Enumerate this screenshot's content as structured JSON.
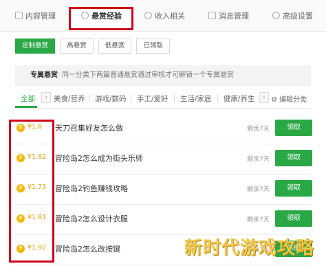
{
  "top_tabs": {
    "content_mgmt": "内容管理",
    "bounty_exp": "悬赏经验",
    "income": "收入相关",
    "messages": "消息管理",
    "advanced": "高级设置"
  },
  "filters": [
    "定制悬赏",
    "高悬赏",
    "低悬赏",
    "已领取"
  ],
  "banner": {
    "title": "专属悬赏",
    "text": "同一分类下两篇普通悬赏通过审核才可解锁一个专属悬赏"
  },
  "categories": {
    "all": "全部",
    "items": [
      "美食/营养",
      "游戏/数码",
      "手工/爱好",
      "生活/家居",
      "健康/养生"
    ],
    "edit": "编辑分类"
  },
  "bounties": [
    {
      "reward": "¥1.6",
      "title": "天刀召集好友怎么做",
      "remaining": "剩余7天",
      "action": "领取"
    },
    {
      "reward": "¥1.62",
      "title": "冒险岛2怎么成为街头乐师",
      "remaining": "剩余7天",
      "action": "领取"
    },
    {
      "reward": "¥1.73",
      "title": "冒险岛2钓鱼赚钱攻略",
      "remaining": "剩余7天",
      "action": "领取"
    },
    {
      "reward": "¥1.81",
      "title": "冒险岛2怎么设计衣服",
      "remaining": "剩余7天",
      "action": "领取"
    },
    {
      "reward": "¥1.92",
      "title": "冒险岛2怎么改按键",
      "remaining": "剩余7天",
      "action": "领取"
    }
  ],
  "coin_glyph": "赏",
  "watermark": "新时代游戏攻略",
  "colors": {
    "accent": "#2aa845",
    "highlight": "#d0021b",
    "reward": "#e8a000"
  }
}
